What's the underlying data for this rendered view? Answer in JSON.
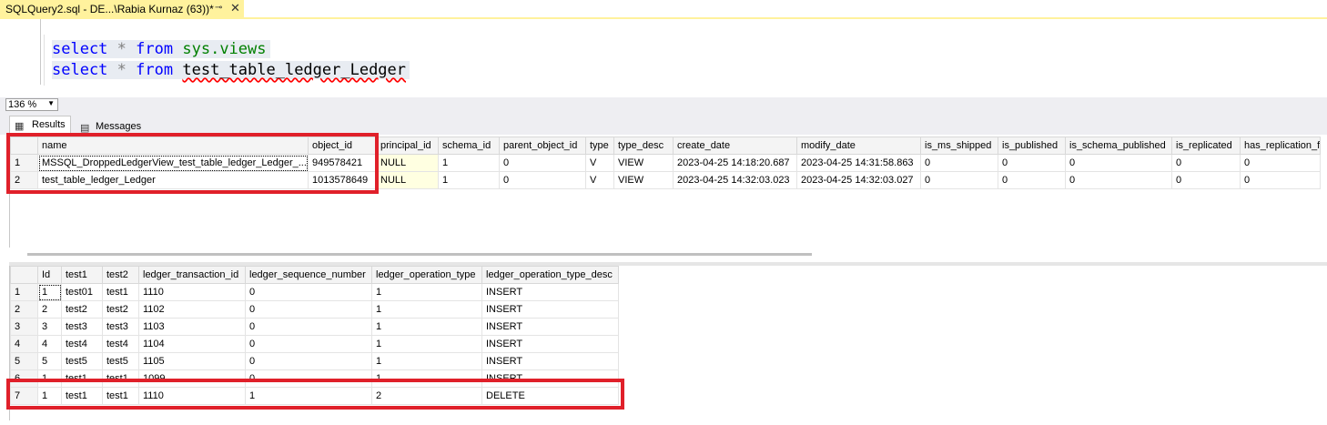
{
  "window": {
    "tab_title": "SQLQuery2.sql - DE...\\Rabia Kurnaz (63))*",
    "pin_icon": "pin-icon",
    "close_icon": "close-icon"
  },
  "editor": {
    "lines": [
      {
        "kw1": "select",
        "star": "*",
        "kw2": "from",
        "object": "sys.views"
      },
      {
        "kw1": "select",
        "star": "*",
        "kw2": "from",
        "object": "test_table_ledger_Ledger"
      }
    ]
  },
  "zoom": {
    "value": "136 %"
  },
  "result_tabs": {
    "results": "Results",
    "messages": "Messages"
  },
  "grid1": {
    "columns": [
      "",
      "name",
      "object_id",
      "principal_id",
      "schema_id",
      "parent_object_id",
      "type",
      "type_desc",
      "create_date",
      "modify_date",
      "is_ms_shipped",
      "is_published",
      "is_schema_published",
      "is_replicated",
      "has_replication_f"
    ],
    "rows": [
      [
        "1",
        "MSSQL_DroppedLedgerView_test_table_ledger_Ledger_...",
        "949578421",
        "NULL",
        "1",
        "0",
        "V",
        "VIEW",
        "2023-04-25 14:18:20.687",
        "2023-04-25 14:31:58.863",
        "0",
        "0",
        "0",
        "0",
        "0"
      ],
      [
        "2",
        "test_table_ledger_Ledger",
        "1013578649",
        "NULL",
        "1",
        "0",
        "V",
        "VIEW",
        "2023-04-25 14:32:03.023",
        "2023-04-25 14:32:03.027",
        "0",
        "0",
        "0",
        "0",
        "0"
      ]
    ]
  },
  "grid2": {
    "columns": [
      "",
      "Id",
      "test1",
      "test2",
      "ledger_transaction_id",
      "ledger_sequence_number",
      "ledger_operation_type",
      "ledger_operation_type_desc"
    ],
    "rows": [
      [
        "1",
        "1",
        "test01",
        "test1",
        "1110",
        "0",
        "1",
        "INSERT"
      ],
      [
        "2",
        "2",
        "test2",
        "test2",
        "1102",
        "0",
        "1",
        "INSERT"
      ],
      [
        "3",
        "3",
        "test3",
        "test3",
        "1103",
        "0",
        "1",
        "INSERT"
      ],
      [
        "4",
        "4",
        "test4",
        "test4",
        "1104",
        "0",
        "1",
        "INSERT"
      ],
      [
        "5",
        "5",
        "test5",
        "test5",
        "1105",
        "0",
        "1",
        "INSERT"
      ],
      [
        "6",
        "1",
        "test1",
        "test1",
        "1099",
        "0",
        "1",
        "INSERT"
      ]
    ],
    "highlight_row": [
      "7",
      "1",
      "test1",
      "test1",
      "1110",
      "1",
      "2",
      "DELETE"
    ]
  },
  "colors": {
    "tab_active": "#fff29d",
    "annotation_red": "#e0202a",
    "keyword_blue": "#0000ff",
    "system_green": "#008000",
    "null_cell": "#ffffe1"
  }
}
